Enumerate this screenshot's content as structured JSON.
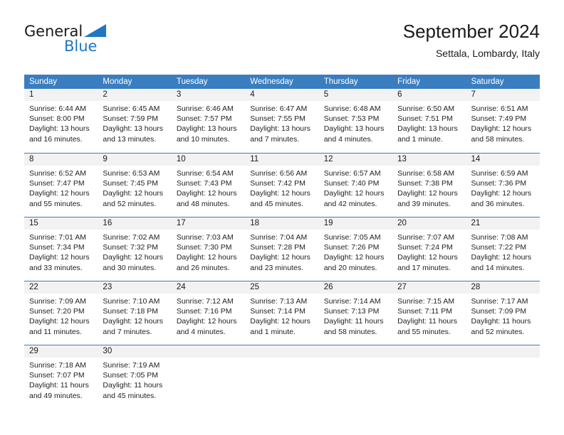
{
  "brand": {
    "name_top": "General",
    "name_bottom": "Blue",
    "flag_icon": "triangle-flag-icon",
    "accent_color": "#1f77c4"
  },
  "header": {
    "title": "September 2024",
    "subtitle": "Settala, Lombardy, Italy"
  },
  "calendar": {
    "header_bg": "#3a7ec0",
    "daynum_bg": "#f2f2f2",
    "weekdays": [
      "Sunday",
      "Monday",
      "Tuesday",
      "Wednesday",
      "Thursday",
      "Friday",
      "Saturday"
    ],
    "weeks": [
      [
        {
          "day": "1",
          "lines": [
            "Sunrise: 6:44 AM",
            "Sunset: 8:00 PM",
            "Daylight: 13 hours",
            "and 16 minutes."
          ]
        },
        {
          "day": "2",
          "lines": [
            "Sunrise: 6:45 AM",
            "Sunset: 7:59 PM",
            "Daylight: 13 hours",
            "and 13 minutes."
          ]
        },
        {
          "day": "3",
          "lines": [
            "Sunrise: 6:46 AM",
            "Sunset: 7:57 PM",
            "Daylight: 13 hours",
            "and 10 minutes."
          ]
        },
        {
          "day": "4",
          "lines": [
            "Sunrise: 6:47 AM",
            "Sunset: 7:55 PM",
            "Daylight: 13 hours",
            "and 7 minutes."
          ]
        },
        {
          "day": "5",
          "lines": [
            "Sunrise: 6:48 AM",
            "Sunset: 7:53 PM",
            "Daylight: 13 hours",
            "and 4 minutes."
          ]
        },
        {
          "day": "6",
          "lines": [
            "Sunrise: 6:50 AM",
            "Sunset: 7:51 PM",
            "Daylight: 13 hours",
            "and 1 minute."
          ]
        },
        {
          "day": "7",
          "lines": [
            "Sunrise: 6:51 AM",
            "Sunset: 7:49 PM",
            "Daylight: 12 hours",
            "and 58 minutes."
          ]
        }
      ],
      [
        {
          "day": "8",
          "lines": [
            "Sunrise: 6:52 AM",
            "Sunset: 7:47 PM",
            "Daylight: 12 hours",
            "and 55 minutes."
          ]
        },
        {
          "day": "9",
          "lines": [
            "Sunrise: 6:53 AM",
            "Sunset: 7:45 PM",
            "Daylight: 12 hours",
            "and 52 minutes."
          ]
        },
        {
          "day": "10",
          "lines": [
            "Sunrise: 6:54 AM",
            "Sunset: 7:43 PM",
            "Daylight: 12 hours",
            "and 48 minutes."
          ]
        },
        {
          "day": "11",
          "lines": [
            "Sunrise: 6:56 AM",
            "Sunset: 7:42 PM",
            "Daylight: 12 hours",
            "and 45 minutes."
          ]
        },
        {
          "day": "12",
          "lines": [
            "Sunrise: 6:57 AM",
            "Sunset: 7:40 PM",
            "Daylight: 12 hours",
            "and 42 minutes."
          ]
        },
        {
          "day": "13",
          "lines": [
            "Sunrise: 6:58 AM",
            "Sunset: 7:38 PM",
            "Daylight: 12 hours",
            "and 39 minutes."
          ]
        },
        {
          "day": "14",
          "lines": [
            "Sunrise: 6:59 AM",
            "Sunset: 7:36 PM",
            "Daylight: 12 hours",
            "and 36 minutes."
          ]
        }
      ],
      [
        {
          "day": "15",
          "lines": [
            "Sunrise: 7:01 AM",
            "Sunset: 7:34 PM",
            "Daylight: 12 hours",
            "and 33 minutes."
          ]
        },
        {
          "day": "16",
          "lines": [
            "Sunrise: 7:02 AM",
            "Sunset: 7:32 PM",
            "Daylight: 12 hours",
            "and 30 minutes."
          ]
        },
        {
          "day": "17",
          "lines": [
            "Sunrise: 7:03 AM",
            "Sunset: 7:30 PM",
            "Daylight: 12 hours",
            "and 26 minutes."
          ]
        },
        {
          "day": "18",
          "lines": [
            "Sunrise: 7:04 AM",
            "Sunset: 7:28 PM",
            "Daylight: 12 hours",
            "and 23 minutes."
          ]
        },
        {
          "day": "19",
          "lines": [
            "Sunrise: 7:05 AM",
            "Sunset: 7:26 PM",
            "Daylight: 12 hours",
            "and 20 minutes."
          ]
        },
        {
          "day": "20",
          "lines": [
            "Sunrise: 7:07 AM",
            "Sunset: 7:24 PM",
            "Daylight: 12 hours",
            "and 17 minutes."
          ]
        },
        {
          "day": "21",
          "lines": [
            "Sunrise: 7:08 AM",
            "Sunset: 7:22 PM",
            "Daylight: 12 hours",
            "and 14 minutes."
          ]
        }
      ],
      [
        {
          "day": "22",
          "lines": [
            "Sunrise: 7:09 AM",
            "Sunset: 7:20 PM",
            "Daylight: 12 hours",
            "and 11 minutes."
          ]
        },
        {
          "day": "23",
          "lines": [
            "Sunrise: 7:10 AM",
            "Sunset: 7:18 PM",
            "Daylight: 12 hours",
            "and 7 minutes."
          ]
        },
        {
          "day": "24",
          "lines": [
            "Sunrise: 7:12 AM",
            "Sunset: 7:16 PM",
            "Daylight: 12 hours",
            "and 4 minutes."
          ]
        },
        {
          "day": "25",
          "lines": [
            "Sunrise: 7:13 AM",
            "Sunset: 7:14 PM",
            "Daylight: 12 hours",
            "and 1 minute."
          ]
        },
        {
          "day": "26",
          "lines": [
            "Sunrise: 7:14 AM",
            "Sunset: 7:13 PM",
            "Daylight: 11 hours",
            "and 58 minutes."
          ]
        },
        {
          "day": "27",
          "lines": [
            "Sunrise: 7:15 AM",
            "Sunset: 7:11 PM",
            "Daylight: 11 hours",
            "and 55 minutes."
          ]
        },
        {
          "day": "28",
          "lines": [
            "Sunrise: 7:17 AM",
            "Sunset: 7:09 PM",
            "Daylight: 11 hours",
            "and 52 minutes."
          ]
        }
      ],
      [
        {
          "day": "29",
          "lines": [
            "Sunrise: 7:18 AM",
            "Sunset: 7:07 PM",
            "Daylight: 11 hours",
            "and 49 minutes."
          ]
        },
        {
          "day": "30",
          "lines": [
            "Sunrise: 7:19 AM",
            "Sunset: 7:05 PM",
            "Daylight: 11 hours",
            "and 45 minutes."
          ]
        },
        {
          "day": "",
          "lines": []
        },
        {
          "day": "",
          "lines": []
        },
        {
          "day": "",
          "lines": []
        },
        {
          "day": "",
          "lines": []
        },
        {
          "day": "",
          "lines": []
        }
      ]
    ]
  }
}
